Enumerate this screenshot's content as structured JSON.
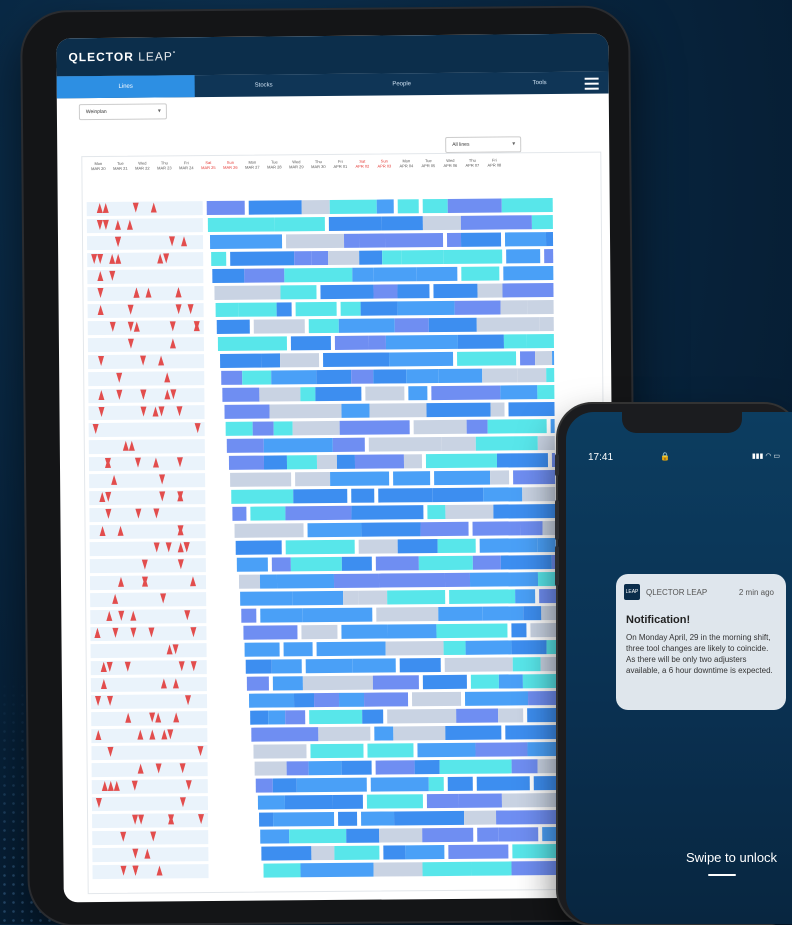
{
  "tablet": {
    "logo_main": "QLECTOR",
    "logo_leap": "LEAP",
    "logo_mark": "°",
    "tabs": [
      {
        "label": "Lines",
        "active": true
      },
      {
        "label": "Stocks",
        "active": false
      },
      {
        "label": "People",
        "active": false
      },
      {
        "label": "Tools",
        "active": false
      }
    ],
    "left_select": "Weinplan",
    "right_select": "All lines",
    "days": [
      {
        "name": "Mon",
        "date": "MAR 20",
        "weekend": false
      },
      {
        "name": "Tue",
        "date": "MAR 21",
        "weekend": false
      },
      {
        "name": "Wed",
        "date": "MAR 22",
        "weekend": false
      },
      {
        "name": "Thu",
        "date": "MAR 23",
        "weekend": false
      },
      {
        "name": "Fri",
        "date": "MAR 24",
        "weekend": false
      },
      {
        "name": "Sat",
        "date": "MAR 25",
        "weekend": true
      },
      {
        "name": "Sun",
        "date": "MAR 26",
        "weekend": true
      },
      {
        "name": "Mon",
        "date": "MAR 27",
        "weekend": false
      },
      {
        "name": "Tue",
        "date": "MAR 28",
        "weekend": false
      },
      {
        "name": "Wed",
        "date": "MAR 29",
        "weekend": false
      },
      {
        "name": "Thu",
        "date": "MAR 30",
        "weekend": false
      },
      {
        "name": "Fri",
        "date": "APR 01",
        "weekend": false
      },
      {
        "name": "Sat",
        "date": "APR 02",
        "weekend": true
      },
      {
        "name": "Sun",
        "date": "APR 03",
        "weekend": true
      },
      {
        "name": "Mon",
        "date": "APR 04",
        "weekend": false
      },
      {
        "name": "Tue",
        "date": "APR 05",
        "weekend": false
      },
      {
        "name": "Wed",
        "date": "APR 06",
        "weekend": false
      },
      {
        "name": "Thu",
        "date": "APR 07",
        "weekend": false
      },
      {
        "name": "Fri",
        "date": "APR 08",
        "weekend": false
      }
    ],
    "bar_colors": [
      "#3d8ef0",
      "#6f8ef2",
      "#58e6ea",
      "#c9d3e3",
      "#4aa0f7"
    ]
  },
  "phone": {
    "time": "17:41",
    "notification": {
      "app": "QLECTOR LEAP",
      "logo": "LEAP",
      "age": "2 min ago",
      "title": "Notification!",
      "body": "On Monday April, 29 in the morning shift, three tool changes are likely to coincide. As there will be only two adjusters available, a 6 hour downtime is expected."
    },
    "swipe": "Swipe to unlock"
  }
}
